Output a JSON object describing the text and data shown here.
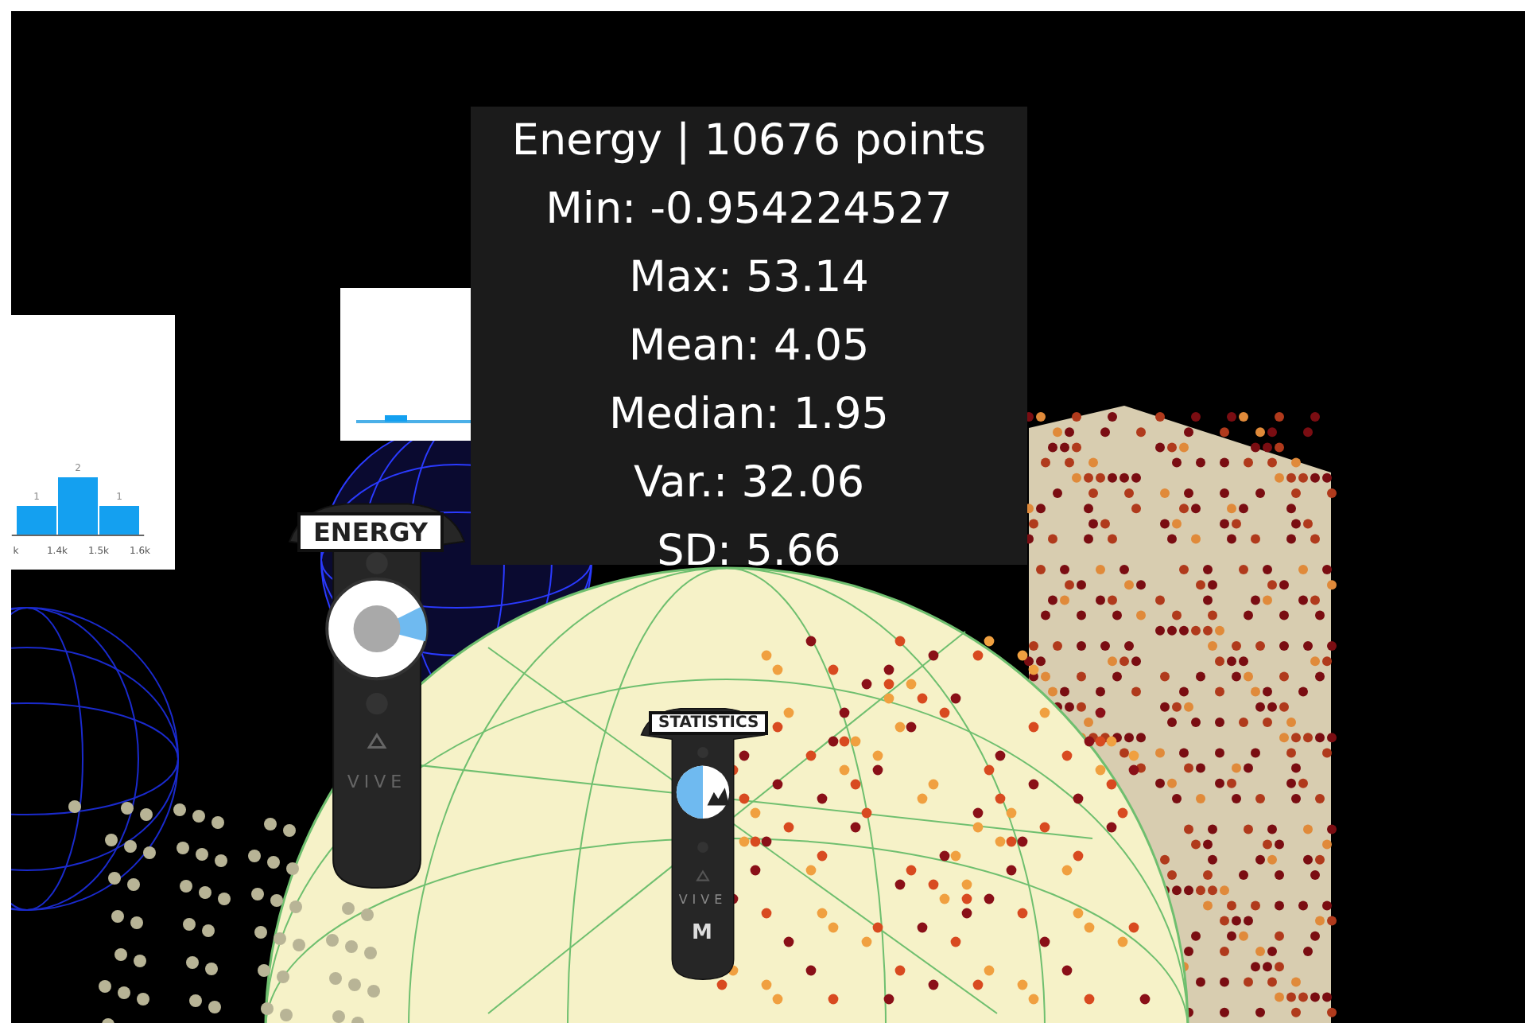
{
  "stats_panel": {
    "title": "Energy | 10676 points",
    "lines": [
      "Min: -0.954224527",
      "Max: 53.14",
      "Mean: 4.05",
      "Median: 1.95",
      "Var.: 32.06",
      "SD: 5.66"
    ]
  },
  "histogram": {
    "chart_data": {
      "type": "bar",
      "x": [
        1350,
        1450,
        1550
      ],
      "values": [
        1,
        2,
        1
      ],
      "data_labels": true,
      "xlim": [
        1290,
        1610
      ],
      "xticks": [
        {
          "value": 1300,
          "label": "k"
        },
        {
          "value": 1400,
          "label": "1.4k"
        },
        {
          "value": 1500,
          "label": "1.5k"
        },
        {
          "value": 1600,
          "label": "1.6k"
        }
      ]
    }
  },
  "controllers": [
    {
      "kind": "touchpad",
      "label": "ENERGY",
      "brand": "VIVE"
    },
    {
      "kind": "menu",
      "label": "STATISTICS",
      "brand": "VIVE",
      "button": "M"
    }
  ]
}
